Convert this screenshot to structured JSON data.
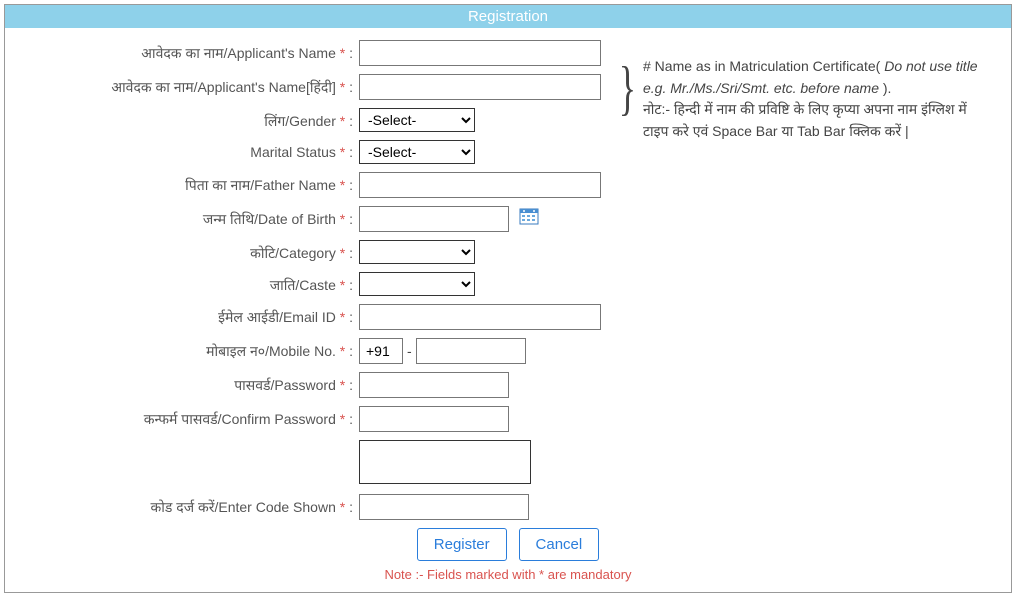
{
  "header": {
    "title": "Registration"
  },
  "hint": {
    "line1_prefix": "# Name as in Matriculation Certificate( ",
    "line1_italic": "Do not use title e.g. Mr./Ms./Sri/Smt. etc. before name",
    "line1_suffix": " ).",
    "line2": "नोट:- हिन्दी में नाम की प्रविष्टि के लिए कृप्या अपना नाम इंग्लिश में टाइप करे एवं Space Bar या Tab Bar क्लिक करें |"
  },
  "labels": {
    "applicant_name": "आवेदक का नाम/Applicant's Name",
    "applicant_name_hindi": "आवेदक का नाम/Applicant's Name[हिंदी]",
    "gender": "लिंग/Gender",
    "marital_status": "Marital Status",
    "father_name": "पिता का नाम/Father Name",
    "dob": "जन्म तिथि/Date of Birth",
    "category": "कोटि/Category",
    "caste": "जाति/Caste",
    "email": "ईमेल आईडी/Email ID",
    "mobile": "मोबाइल न०/Mobile No.",
    "password": "पासवर्ड/Password",
    "confirm_password": "कन्फर्म पासवर्ड/Confirm Password",
    "enter_code": "कोड दर्ज करें/Enter Code Shown",
    "star": "*",
    "colon": ":"
  },
  "values": {
    "applicant_name": "",
    "applicant_name_hindi": "",
    "gender_selected": "-Select-",
    "marital_selected": "-Select-",
    "father_name": "",
    "dob": "",
    "category_selected": "",
    "caste_selected": "",
    "email": "",
    "mobile_prefix": "+91",
    "mobile_dash": "-",
    "mobile_number": "",
    "password": "",
    "confirm_password": "",
    "enter_code": ""
  },
  "buttons": {
    "register": "Register",
    "cancel": "Cancel"
  },
  "footer": {
    "mandatory_note": "Note :- Fields marked with * are mandatory"
  },
  "brace": "}"
}
